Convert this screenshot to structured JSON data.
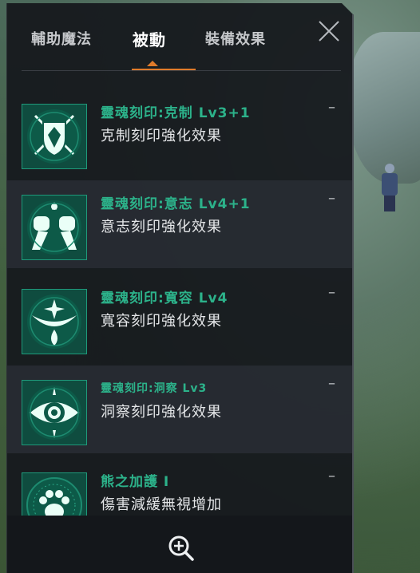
{
  "tabs": [
    {
      "label": "輔助魔法"
    },
    {
      "label": "被動"
    },
    {
      "label": "裝備效果"
    }
  ],
  "items": [
    {
      "title": "靈魂刻印:克制 Lv3+1",
      "desc": "克制刻印強化效果",
      "dash": "–",
      "icon": "shield-swords-icon"
    },
    {
      "title": "靈魂刻印:意志 Lv4+1",
      "desc": "意志刻印強化效果",
      "dash": "–",
      "icon": "fists-icon"
    },
    {
      "title": "靈魂刻印:寬容 Lv4",
      "desc": "寬容刻印強化效果",
      "dash": "–",
      "icon": "star-drop-icon"
    },
    {
      "title": "靈魂刻印:洞察 Lv3",
      "desc": "洞察刻印強化效果",
      "dash": "–",
      "icon": "eye-icon"
    },
    {
      "title": "熊之加護 I",
      "desc": "傷害減緩無視增加",
      "dash": "–",
      "icon": "bear-paw-icon"
    }
  ],
  "colors": {
    "accent": "#e07b2a",
    "title_green": "#2cb28a",
    "icon_bg": "#0f4c3f"
  }
}
